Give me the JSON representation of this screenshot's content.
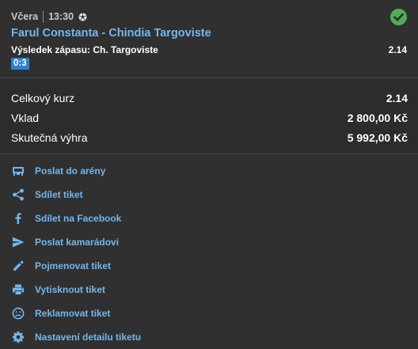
{
  "bet": {
    "day": "Včera",
    "time": "13:30",
    "sport_icon": "soccer-ball-icon",
    "status_icon": "check-circle-icon",
    "match": "Farul Constanta - Chindia Targoviste",
    "selection": "Výsledek zápasu: Ch. Targoviste",
    "odd": "2.14",
    "score": "0:3"
  },
  "summary": {
    "total_odds_label": "Celkový kurz",
    "total_odds_value": "2.14",
    "stake_label": "Vklad",
    "stake_value": "2 800,00 Kč",
    "win_label": "Skutečná výhra",
    "win_value": "5 992,00 Kč"
  },
  "actions": [
    {
      "label": "Poslat do arény",
      "icon": "arena-icon"
    },
    {
      "label": "Sdílet tiket",
      "icon": "share-icon"
    },
    {
      "label": "Sdílet na Facebook",
      "icon": "facebook-icon"
    },
    {
      "label": "Poslat kamarádovi",
      "icon": "send-icon"
    },
    {
      "label": "Pojmenovat tiket",
      "icon": "pencil-icon"
    },
    {
      "label": "Vytisknout tiket",
      "icon": "printer-icon"
    },
    {
      "label": "Reklamovat tiket",
      "icon": "sad-face-icon"
    },
    {
      "label": "Nastavení detailu tiketu",
      "icon": "gear-icon"
    }
  ],
  "colors": {
    "background": "#303030",
    "link": "#72b7ec",
    "success": "#4fae53",
    "score_badge": "#2e7fd0"
  }
}
